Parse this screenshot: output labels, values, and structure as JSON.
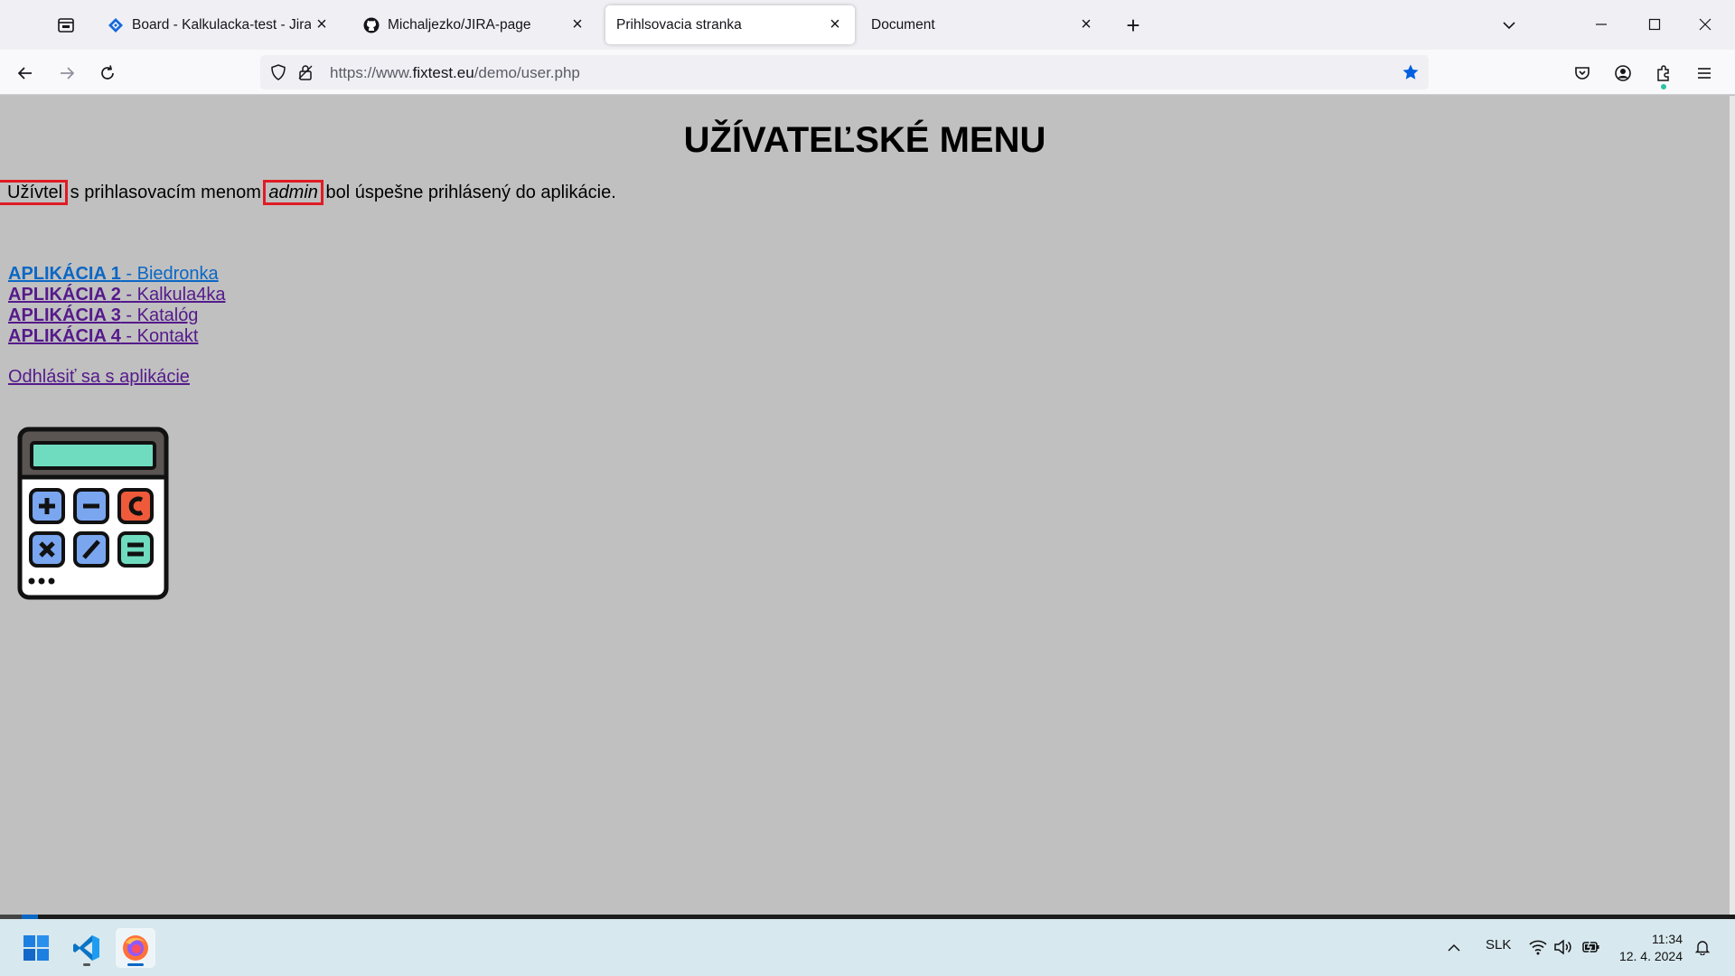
{
  "browser": {
    "tabs": [
      {
        "title": "Board - Kalkulacka-test - Jira",
        "icon": "jira-icon",
        "active": false
      },
      {
        "title": "Michaljezko/JIRA-page",
        "icon": "github-icon",
        "active": false
      },
      {
        "title": "Prihlsovacia stranka",
        "icon": "",
        "active": true
      },
      {
        "title": "Document",
        "icon": "",
        "active": false
      }
    ],
    "close_glyph": "×",
    "new_tab_glyph": "+",
    "url": {
      "scheme": "https://www.",
      "domain": "fixtest.eu",
      "path": "/demo/user.php"
    }
  },
  "page": {
    "title": "UŽÍVATEĽSKÉ MENU",
    "user_label": "Užívtel",
    "message_middle": " s prihlasovacím menom ",
    "username": "admin",
    "message_end": " bol úspešne prihlásený do aplikácie.",
    "apps": [
      {
        "bold": "APLIKÁCIA 1",
        "name": " - Biedronka"
      },
      {
        "bold": "APLIKÁCIA 2",
        "name": " - Kalkula4ka"
      },
      {
        "bold": "APLIKÁCIA 3",
        "name": " - Katalóg"
      },
      {
        "bold": "APLIKÁCIA 4",
        "name": " - Kontakt"
      }
    ],
    "logout": "Odhlásiť sa s aplikácie",
    "image": "calculator-icon"
  },
  "taskbar": {
    "apps": [
      "windows-start-icon",
      "vscode-icon",
      "firefox-icon"
    ],
    "language": "SLK",
    "time": "11:34",
    "date": "12. 4. 2024"
  },
  "colors": {
    "page_bg": "#c0c0c0",
    "link_visited": "#551a8b",
    "link_unvisited": "#0b67c5",
    "highlight_border": "#e01b24",
    "bookmark_star": "#0060df"
  }
}
